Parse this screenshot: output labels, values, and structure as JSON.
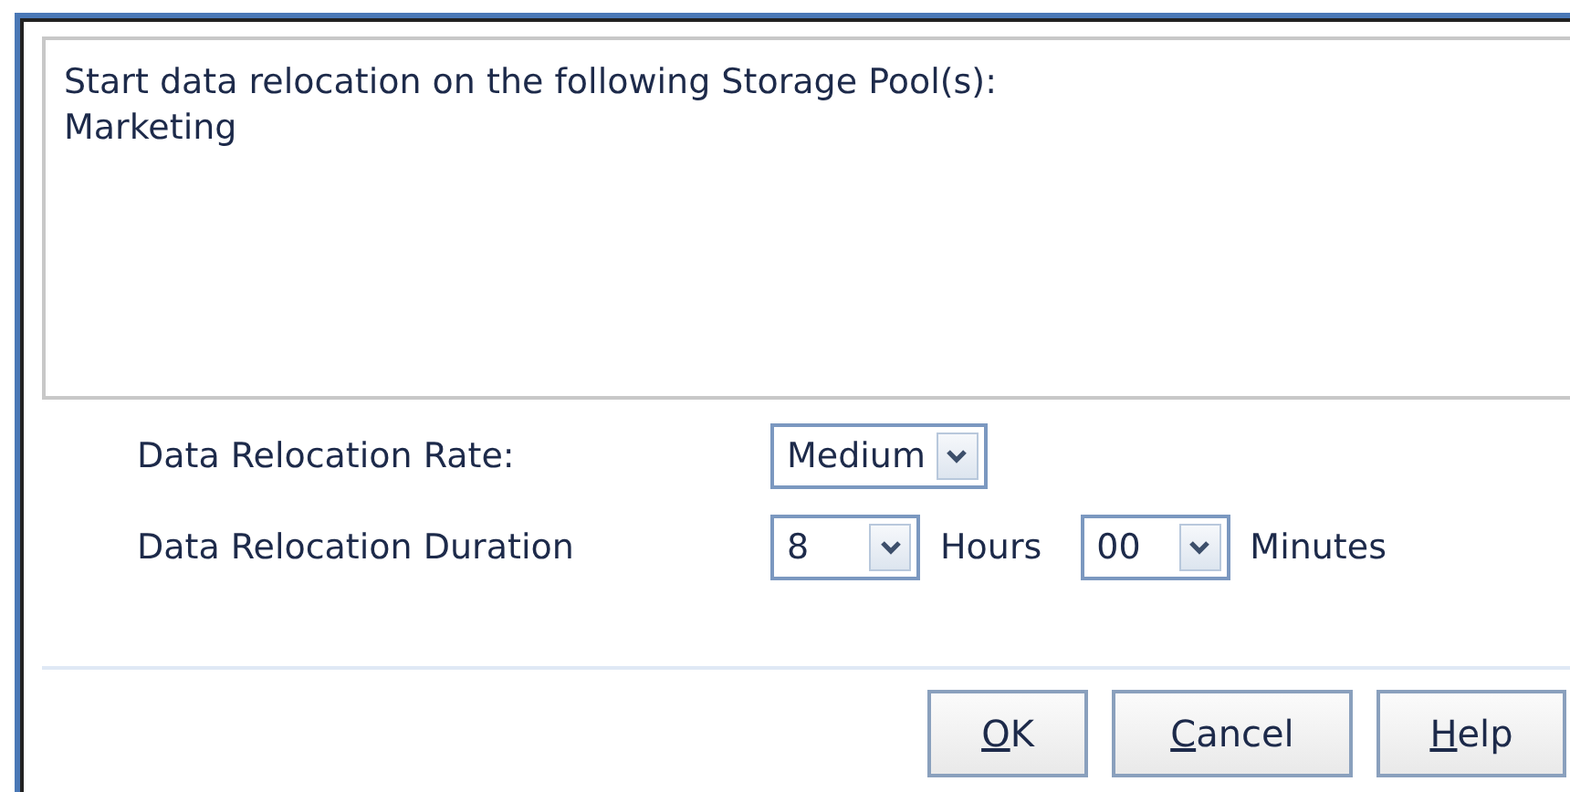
{
  "message": {
    "lines": [
      "Start data relocation on the following Storage Pool(s):",
      "Marketing"
    ]
  },
  "settings": [
    {
      "label": "Data Relocation Rate:",
      "controls": [
        {
          "kind": "dropdown",
          "value": "Medium"
        }
      ]
    },
    {
      "label": "Data Relocation Duration",
      "controls": [
        {
          "kind": "dropdown",
          "value": "8"
        },
        {
          "kind": "unit",
          "text": "Hours"
        },
        {
          "kind": "dropdown",
          "value": "00"
        },
        {
          "kind": "unit",
          "text": "Minutes"
        }
      ]
    }
  ],
  "buttons": [
    {
      "label": "OK",
      "underline_first": true
    },
    {
      "label": "Cancel",
      "underline_first": true
    },
    {
      "label": "Help",
      "underline_first": true
    }
  ]
}
